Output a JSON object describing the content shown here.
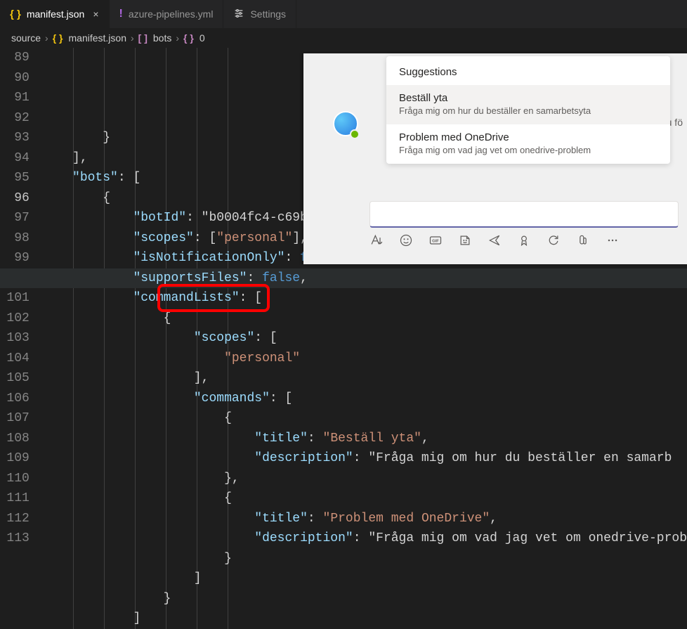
{
  "tabs": [
    {
      "label": "manifest.json",
      "icon": "{ }",
      "active": true,
      "closable": true
    },
    {
      "label": "azure-pipelines.yml",
      "icon": "!",
      "active": false,
      "closable": false
    },
    {
      "label": "Settings",
      "icon": "⚙",
      "active": false,
      "closable": false
    }
  ],
  "breadcrumb": {
    "items": [
      "source",
      "manifest.json",
      "bots",
      "0"
    ],
    "icons": [
      "",
      "{ }",
      "[ ]",
      "{ }"
    ]
  },
  "editor": {
    "first_line": 89,
    "current_line": 96,
    "lines": [
      "        }",
      "    ],",
      "    \"bots\": [",
      "        {",
      "            \"botId\": \"b0004fc4-c69b",
      "            \"scopes\": [\"personal\"],",
      "            \"isNotificationOnly\": f",
      "            \"supportsFiles\": false,",
      "            \"commandLists\": [",
      "                {",
      "                    \"scopes\": [",
      "                        \"personal\"",
      "                    ],",
      "                    \"commands\": [",
      "                        {",
      "                            \"title\": \"Beställ yta\",",
      "                            \"description\": \"Fråga mig om hur du beställer en samarb",
      "                        },",
      "                        {",
      "                            \"title\": \"Problem med OneDrive\",",
      "                            \"description\": \"Fråga mig om vad jag vet om onedrive-prob",
      "                        }",
      "                    ]",
      "                }",
      "            ]"
    ]
  },
  "teams": {
    "suggestions_title": "Suggestions",
    "items": [
      {
        "title": "Beställ yta",
        "desc": "Fråga mig om hur du beställer en samarbetsyta"
      },
      {
        "title": "Problem med OneDrive",
        "desc": "Fråga mig om vad jag vet om onedrive-problem"
      }
    ],
    "hint_fragment": "n du fö",
    "toolbar_icons": [
      "format-icon",
      "emoji-icon",
      "gif-icon",
      "sticker-icon",
      "send-icon",
      "praise-icon",
      "loop-icon",
      "attachment-icon",
      "more-icon"
    ]
  }
}
